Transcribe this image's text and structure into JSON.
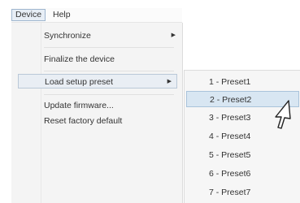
{
  "menubar": {
    "items": [
      {
        "label": "Device"
      },
      {
        "label": "Help"
      }
    ]
  },
  "device_menu": {
    "items": [
      {
        "label": "Synchronize",
        "submenu_arrow": "▶"
      },
      {
        "label": "Finalize the device"
      },
      {
        "label": "Load setup preset",
        "submenu_arrow": "▶",
        "highlighted": true
      },
      {
        "label": "Update firmware..."
      },
      {
        "label": "Reset factory default"
      }
    ]
  },
  "preset_submenu": {
    "items": [
      {
        "label": "1 - Preset1"
      },
      {
        "label": "2 - Preset2",
        "highlighted": true
      },
      {
        "label": "3 - Preset3"
      },
      {
        "label": "4 - Preset4"
      },
      {
        "label": "5 - Preset5"
      },
      {
        "label": "6 - Preset6"
      },
      {
        "label": "7 - Preset7"
      }
    ]
  },
  "colors": {
    "highlight_bg": "#e9eef4",
    "submenu_highlight_bg": "#d8e6f2",
    "menu_bg": "#f4f4f4"
  },
  "icons": {
    "cursor": "mouse-pointer-icon",
    "submenu_arrow": "submenu-arrow-icon"
  }
}
